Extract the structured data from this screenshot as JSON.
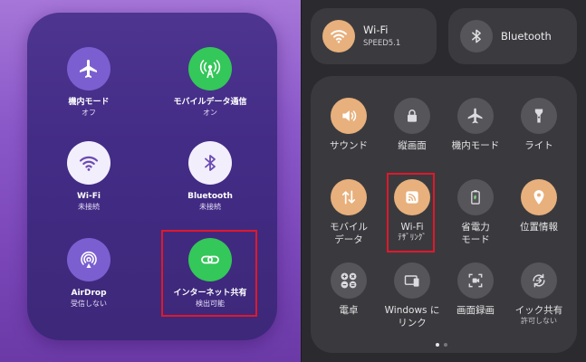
{
  "ios": {
    "tiles": [
      {
        "name": "機内モード",
        "status": "オフ",
        "icon": "airplane-icon",
        "circle_color": "#7b5fd1",
        "icon_color": "#ffffff"
      },
      {
        "name": "モバイルデータ通信",
        "status": "オン",
        "icon": "cellular-antenna-icon",
        "circle_color": "#34c759",
        "icon_color": "#ffffff"
      },
      {
        "name": "Wi-Fi",
        "status": "未接続",
        "icon": "wifi-icon",
        "circle_color": "#f3eefc",
        "icon_color": "#6a4bb4"
      },
      {
        "name": "Bluetooth",
        "status": "未接続",
        "icon": "bluetooth-icon",
        "circle_color": "#f3eefc",
        "icon_color": "#6a4bb4"
      },
      {
        "name": "AirDrop",
        "status": "受信しない",
        "icon": "airdrop-icon",
        "circle_color": "#7b5fd1",
        "icon_color": "#ffffff"
      },
      {
        "name": "インターネット共有",
        "status": "検出可能",
        "icon": "personal-hotspot-icon",
        "circle_color": "#34c759",
        "icon_color": "#ffffff"
      }
    ]
  },
  "android": {
    "top": {
      "wifi": {
        "label": "Wi-Fi",
        "sub": "SPEED5.1"
      },
      "bluetooth": {
        "label": "Bluetooth"
      }
    },
    "tiles": [
      {
        "label": "サウンド",
        "sub": "",
        "icon": "speaker-icon",
        "state": "on"
      },
      {
        "label": "縦画面",
        "sub": "",
        "icon": "lock-icon",
        "state": "off"
      },
      {
        "label": "機内モード",
        "sub": "",
        "icon": "airplane-icon",
        "state": "off"
      },
      {
        "label": "ライト",
        "sub": "",
        "icon": "flashlight-icon",
        "state": "off"
      },
      {
        "label": "モバイル\nデータ",
        "sub": "",
        "icon": "mobile-data-arrows-icon",
        "state": "on"
      },
      {
        "label": "Wi-Fi",
        "sub": "ﾃｻﾞﾘﾝｸﾞ",
        "icon": "wifi-tethering-icon",
        "state": "on"
      },
      {
        "label": "省電力\nモード",
        "sub": "",
        "icon": "battery-saver-icon",
        "state": "off"
      },
      {
        "label": "位置情報",
        "sub": "",
        "icon": "location-pin-icon",
        "state": "on"
      },
      {
        "label": "電卓",
        "sub": "",
        "icon": "calculator-icon",
        "state": "off"
      },
      {
        "label": "Windows に\nリンク",
        "sub": "",
        "icon": "link-to-windows-icon",
        "state": "off"
      },
      {
        "label": "画面録画",
        "sub": "",
        "icon": "screen-record-icon",
        "state": "off"
      },
      {
        "label": "イック共有",
        "sub": "許可しない",
        "icon": "quick-share-icon",
        "state": "off"
      }
    ],
    "colors": {
      "on": "#e8b07c",
      "off": "#55555a"
    }
  }
}
